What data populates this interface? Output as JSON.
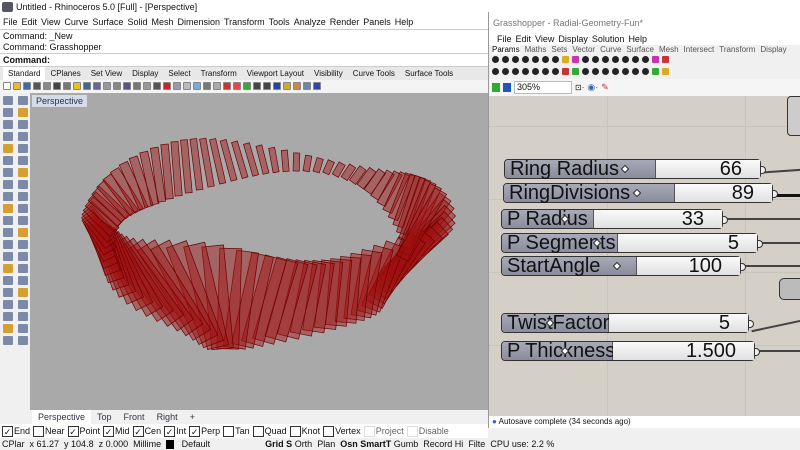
{
  "rhino": {
    "title": "Untitled - Rhinoceros 5.0 [Full] - [Perspective]",
    "menu": [
      "File",
      "Edit",
      "View",
      "Curve",
      "Surface",
      "Solid",
      "Mesh",
      "Dimension",
      "Transform",
      "Tools",
      "Analyze",
      "Render",
      "Panels",
      "Help"
    ],
    "history": [
      "Command: _New",
      "Command: Grasshopper"
    ],
    "command_label": "Command:",
    "toolbar_tabs": [
      "Standard",
      "CPlanes",
      "Set View",
      "Display",
      "Select",
      "Transform",
      "Viewport Layout",
      "Visibility",
      "Curve Tools",
      "Surface Tools"
    ],
    "active_tab": "Standard",
    "viewport_label": "Perspective",
    "viewport_tabs": [
      "Perspective",
      "Top",
      "Front",
      "Right",
      "+"
    ],
    "osnaps": [
      {
        "label": "End",
        "checked": true
      },
      {
        "label": "Near",
        "checked": false
      },
      {
        "label": "Point",
        "checked": true
      },
      {
        "label": "Mid",
        "checked": true
      },
      {
        "label": "Cen",
        "checked": true
      },
      {
        "label": "Int",
        "checked": true
      },
      {
        "label": "Perp",
        "checked": true
      },
      {
        "label": "Tan",
        "checked": false
      },
      {
        "label": "Quad",
        "checked": false
      },
      {
        "label": "Knot",
        "checked": false
      },
      {
        "label": "Vertex",
        "checked": false
      },
      {
        "label": "Project",
        "checked": false,
        "disabled": true
      },
      {
        "label": "Disable",
        "checked": false,
        "disabled": true
      }
    ],
    "status": {
      "cplane": "CPlar",
      "x": "x 61.27",
      "y": "y 104.8",
      "z": "z 0.000",
      "units": "Millime",
      "layer": "Default",
      "grid": "Grid S",
      "ortho": "Orth",
      "planar": "Plan",
      "osnap": "Osn",
      "smarttrack": "SmartT",
      "gumball": "Gumb",
      "record": "Record Hi",
      "filter": "Filte",
      "cpu": "CPU use: 2.2 %"
    },
    "geometry_color": "#a01010"
  },
  "grasshopper": {
    "title": "Grasshopper - Radial-Geometry-Fun*",
    "menu": [
      "File",
      "Edit",
      "View",
      "Display",
      "Solution",
      "Help"
    ],
    "tabs": [
      "Params",
      "Maths",
      "Sets",
      "Vector",
      "Curve",
      "Surface",
      "Mesh",
      "Intersect",
      "Transform",
      "Display"
    ],
    "active_tab": "Params",
    "zoom": "305%",
    "sliders": [
      {
        "label": "Ring Radius",
        "value": "66"
      },
      {
        "label": "RingDivisions",
        "value": "89"
      },
      {
        "label": "P Radius",
        "value": "33"
      },
      {
        "label": "P Segments",
        "value": "5"
      },
      {
        "label": "StartAngle",
        "value": "100"
      },
      {
        "label": "TwistFactor",
        "value": "5"
      },
      {
        "label": "P Thickness",
        "value": "1.500"
      }
    ],
    "footer": "Autosave complete (34 seconds ago)"
  }
}
